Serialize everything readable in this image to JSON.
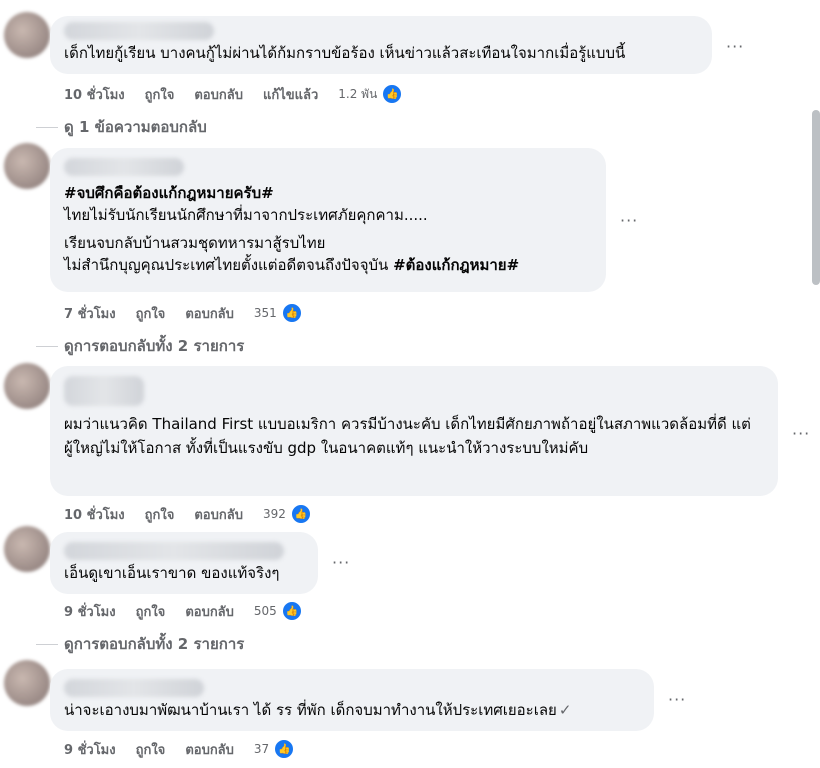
{
  "comments": [
    {
      "text": "เด็กไทยกู้เรียน บางคนกู้ไม่ผ่านได้ก้มกราบข้อร้อง เห็นข่าวแล้วสะเทือนใจมากเมื่อรู้แบบนี้",
      "time": "10 ชั่วโมง",
      "like": "ถูกใจ",
      "reply": "ตอบกลับ",
      "edited": "แก้ไขแล้ว",
      "reactions": "1.2 พัน"
    },
    {
      "hashtag_line": "#จบศึกคือต้องแก้กฎหมายครับ#",
      "line2": "ไทยไม่รับนักเรียนนักศึกษาที่มาจากประเทศภัยคุกคาม.....",
      "line3": "เรียนจบกลับบ้านสวมชุดทหารมาสู้รบไทย",
      "line4_start": "ไม่สำนึกบุญคุณประเทศไทยตั้งแต่อดีตจนถึงปัจจุบัน ",
      "line4_bold": "#ต้องแก้กฎหมาย#",
      "time": "7 ชั่วโมง",
      "like": "ถูกใจ",
      "reply": "ตอบกลับ",
      "reactions": "351"
    },
    {
      "text": "ผมว่าแนวคิด Thailand First แบบอเมริกา ควรมีบ้างนะคับ เด็กไทยมีศักยภาพถ้าอยู่ในสภาพแวดล้อมที่ดี แต่ผู้ใหญ่ไม่ให้โอกาส ทั้งที่เป็นแรงขับ gdp ในอนาคตแท้ๆ แนะนำให้วางระบบใหม่คับ",
      "time": "10 ชั่วโมง",
      "like": "ถูกใจ",
      "reply": "ตอบกลับ",
      "reactions": "392"
    },
    {
      "text": "เอ็นดูเขาเอ็นเราขาด ของแท้จริงๆ",
      "time": "9 ชั่วโมง",
      "like": "ถูกใจ",
      "reply": "ตอบกลับ",
      "reactions": "505"
    },
    {
      "text": "น่าจะเอางบมาพัฒนาบ้านเรา ได้ รร ที่พัก เด็กจบมาทำงานให้ประเทศเยอะเลย",
      "time": "9 ชั่วโมง",
      "like": "ถูกใจ",
      "reply": "ตอบกลับ",
      "reactions": "37"
    }
  ],
  "reply_links": {
    "view_one": "ดู 1 ข้อความตอบกลับ",
    "view_all_1": "ดูการตอบกลับทั้ง 2 รายการ",
    "view_all_2": "ดูการตอบกลับทั้ง 2 รายการ"
  },
  "more_glyph": "···",
  "check_glyph": "✓",
  "like_glyph": "👍",
  "colors": {
    "bubble": "#f0f2f5",
    "like_blue": "#1877f2",
    "meta": "#65676b"
  }
}
